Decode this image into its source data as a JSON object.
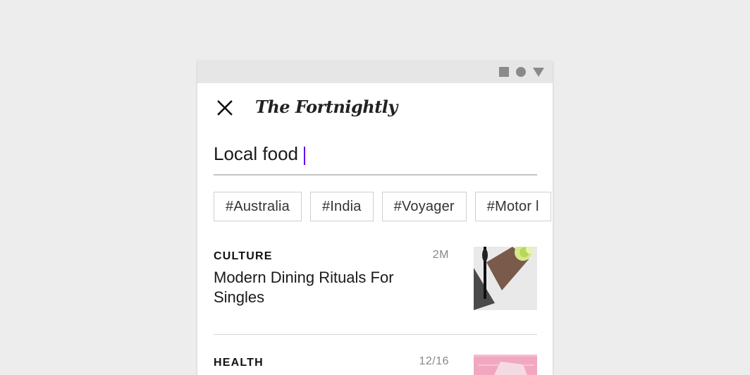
{
  "app": {
    "brand": "The Fortnightly"
  },
  "search": {
    "query": "Local food"
  },
  "chips": [
    "#Australia",
    "#India",
    "#Voyager",
    "#Motor l"
  ],
  "articles": [
    {
      "category": "CULTURE",
      "time": "2M",
      "headline": "Modern Dining Rituals For Singles"
    },
    {
      "category": "HEALTH",
      "time": "12/16",
      "headline": ""
    }
  ],
  "colors": {
    "caret": "#6200ee",
    "background": "#ededed",
    "statusbar": "#e6e6e6"
  }
}
